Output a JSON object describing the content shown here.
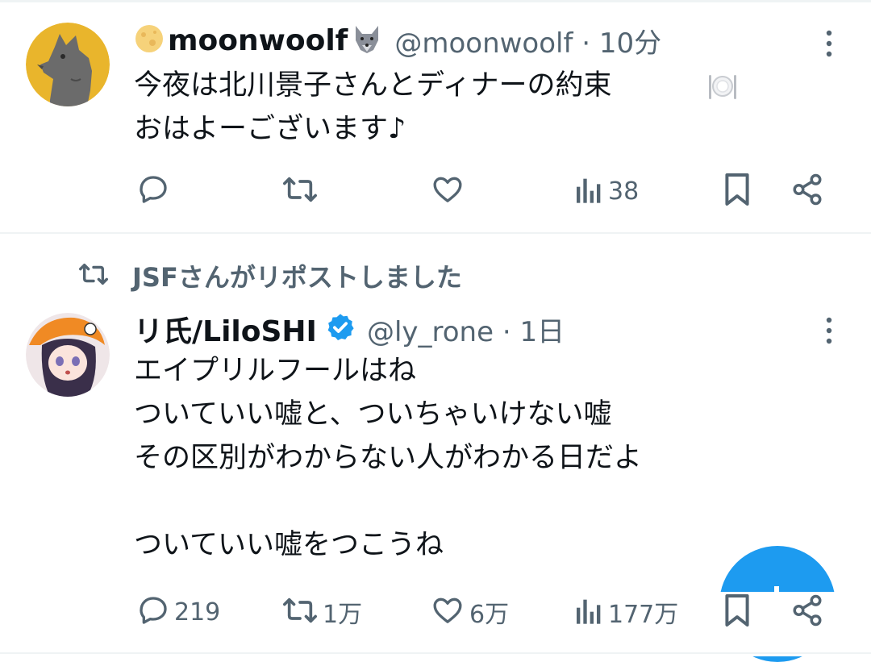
{
  "tweets": [
    {
      "display_name": "moonwoolf",
      "handle_time": "@moonwoolf · 10分",
      "text": "今夜は北川景子さんとディナーの約束\nおはよーございます♪",
      "avatar_colors": {
        "background": "#e9b52c",
        "figure": "#6b6b6b"
      },
      "actions": {
        "reply": "",
        "repost": "",
        "like": "",
        "views": "38"
      }
    },
    {
      "repost_label": "JSFさんがリポストしました",
      "display_name": "リ氏/LiloSHI",
      "verified": true,
      "handle_time": "@ly_rone · 1日",
      "text": "エイプリルフールはね\nついていい嘘と、ついちゃいけない嘘\nその区別がわからない人がわかる日だよ\n\nついていい嘘をつこうね",
      "actions": {
        "reply": "219",
        "repost": "1万",
        "like": "6万",
        "views": "177万"
      }
    }
  ],
  "colors": {
    "text": "#0f1419",
    "secondary": "#536471",
    "accent": "#1d9bf0",
    "divider": "#eff3f4"
  },
  "icons": [
    "more-vertical-icon",
    "reply-icon",
    "repost-icon",
    "like-icon",
    "views-icon",
    "bookmark-icon",
    "share-icon",
    "verified-badge-icon",
    "moon-emoji-icon",
    "wolf-emoji-icon",
    "plate-emoji-icon"
  ]
}
